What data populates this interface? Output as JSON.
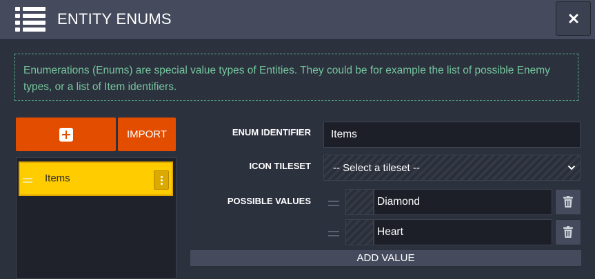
{
  "header": {
    "title": "ENTITY ENUMS",
    "menu_icon": "list-icon",
    "close_icon": "close-icon"
  },
  "info": {
    "text": "Enumerations (Enums) are special value types of Entities. They could be for example the list of possible Enemy types, or a list of Item identifiers."
  },
  "sidebar": {
    "add_icon": "plus-square-icon",
    "import_label": "IMPORT",
    "items": [
      {
        "label": "Items",
        "selected": true
      }
    ]
  },
  "form": {
    "identifier_label": "ENUM IDENTIFIER",
    "identifier_value": "Items",
    "tileset_label": "ICON TILESET",
    "tileset_selected": "-- Select a tileset --",
    "values_label": "POSSIBLE VALUES",
    "values": [
      {
        "name": "Diamond"
      },
      {
        "name": "Heart"
      }
    ],
    "add_value_label": "ADD VALUE"
  },
  "colors": {
    "background": "#2c313e",
    "header": "#454b5d",
    "accent_orange": "#e34d00",
    "selected_item": "#ffcc00",
    "info_text": "#75c79d"
  }
}
